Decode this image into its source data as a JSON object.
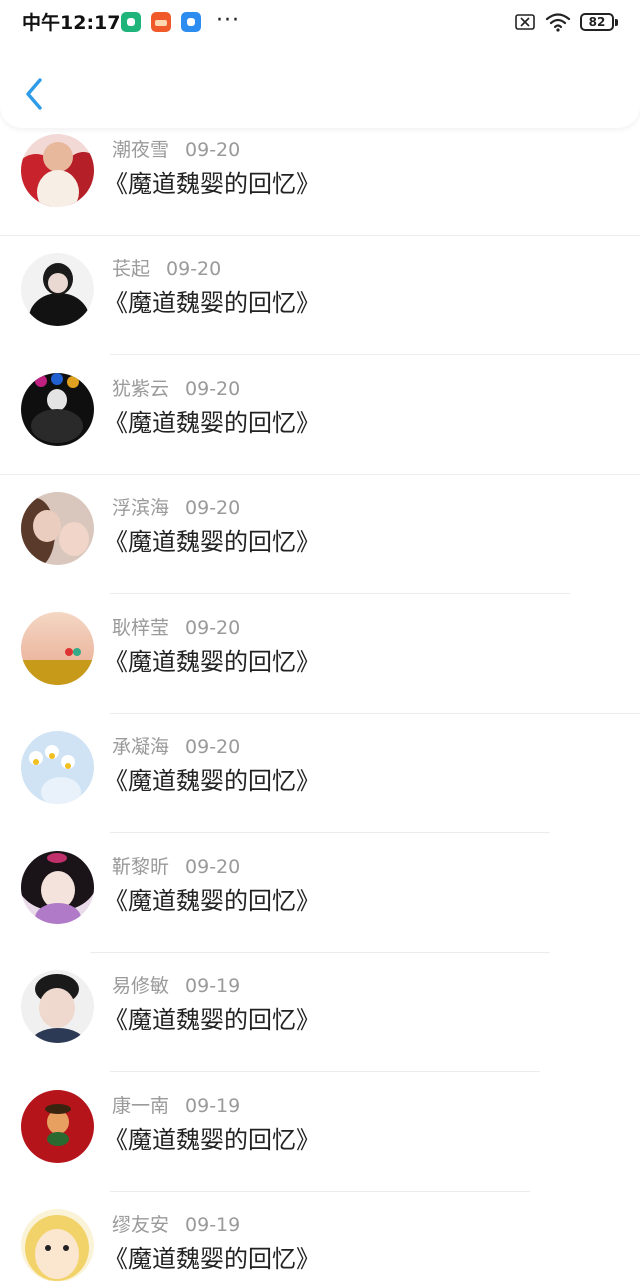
{
  "status_bar": {
    "time": "中午12:17",
    "more": "···",
    "battery": "82"
  },
  "header": {
    "back_icon": "chevron-left-icon",
    "accent_color": "#2d9be8"
  },
  "list": [
    {
      "name": "潮夜雪",
      "date": "09-20",
      "title": "《魔道魏婴的回忆》"
    },
    {
      "name": "苌起",
      "date": "09-20",
      "title": "《魔道魏婴的回忆》"
    },
    {
      "name": "犹紫云",
      "date": "09-20",
      "title": "《魔道魏婴的回忆》"
    },
    {
      "name": "浮滨海",
      "date": "09-20",
      "title": "《魔道魏婴的回忆》"
    },
    {
      "name": "耿梓莹",
      "date": "09-20",
      "title": "《魔道魏婴的回忆》"
    },
    {
      "name": "承凝海",
      "date": "09-20",
      "title": "《魔道魏婴的回忆》"
    },
    {
      "name": "靳黎昕",
      "date": "09-20",
      "title": "《魔道魏婴的回忆》"
    },
    {
      "name": "易修敏",
      "date": "09-19",
      "title": "《魔道魏婴的回忆》"
    },
    {
      "name": "康一南",
      "date": "09-19",
      "title": "《魔道魏婴的回忆》"
    },
    {
      "name": "缪友安",
      "date": "09-19",
      "title": "《魔道魏婴的回忆》"
    }
  ]
}
